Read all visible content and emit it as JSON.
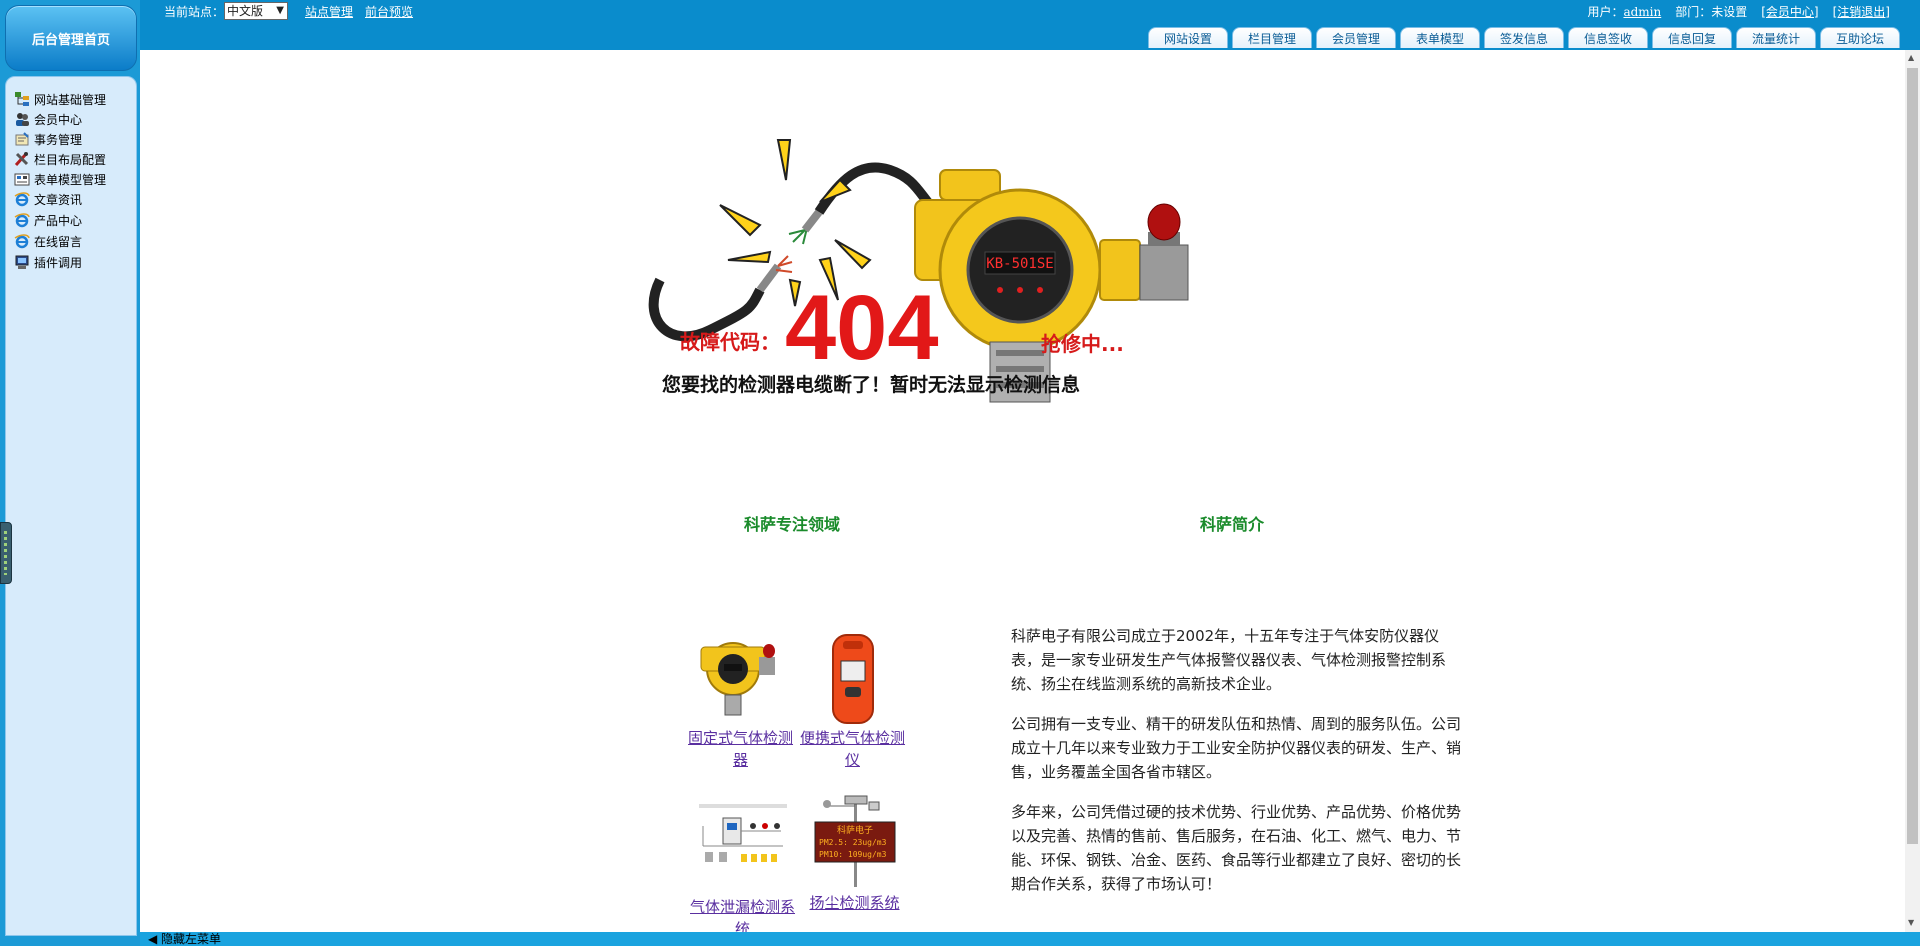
{
  "sidebar": {
    "home": "后台管理首页",
    "items": [
      {
        "label": "网站基础管理",
        "icon": "site-tree-icon"
      },
      {
        "label": "会员中心",
        "icon": "users-icon"
      },
      {
        "label": "事务管理",
        "icon": "tasks-icon"
      },
      {
        "label": "栏目布局配置",
        "icon": "tools-icon"
      },
      {
        "label": "表单模型管理",
        "icon": "form-icon"
      },
      {
        "label": "文章资讯",
        "icon": "ie-icon"
      },
      {
        "label": "产品中心",
        "icon": "ie-icon"
      },
      {
        "label": "在线留言",
        "icon": "ie-icon"
      },
      {
        "label": "插件调用",
        "icon": "computer-icon"
      }
    ]
  },
  "topbar": {
    "site_label": "当前站点：",
    "site_value": "中文版",
    "site_manage": "站点管理",
    "front_preview": "前台预览",
    "user_label": "用户：",
    "user_name": "admin",
    "dept": "部门：未设置",
    "member_center": "[会员中心]",
    "logout": "[注销退出]"
  },
  "tabs": [
    "网站设置",
    "栏目管理",
    "会员管理",
    "表单模型",
    "签发信息",
    "信息签收",
    "信息回复",
    "流量统计",
    "互助论坛"
  ],
  "error": {
    "code_label": "故障代码：",
    "code": "404",
    "repair": "抢修中...",
    "message": "您要找的检测器电缆断了！暂时无法显示检测信息",
    "device_text": "KB-501SE"
  },
  "focus": {
    "title": "科萨专注领域",
    "products": [
      {
        "name": "固定式气体检测器"
      },
      {
        "name": "便携式气体检测仪"
      },
      {
        "name": "气体泄漏检测系统"
      },
      {
        "name": "扬尘检测系统"
      }
    ]
  },
  "dust_display": {
    "brand": "科萨电子",
    "line1": "PM2.5:  23ug/m3",
    "line2": "PM10:  109ug/m3"
  },
  "intro": {
    "title": "科萨简介",
    "paragraphs": [
      "科萨电子有限公司成立于2002年，十五年专注于气体安防仪器仪表，是一家专业研发生产气体报警仪器仪表、气体检测报警控制系统、扬尘在线监测系统的高新技术企业。",
      "公司拥有一支专业、精干的研发队伍和热情、周到的服务队伍。公司成立十几年以来专业致力于工业安全防护仪器仪表的研发、生产、销售，业务覆盖全国各省市辖区。",
      "多年来，公司凭借过硬的技术优势、行业优势、产品优势、价格优势以及完善、热情的售前、售后服务，在石油、化工、燃气、电力、节能、环保、钢铁、冶金、医药、食品等行业都建立了良好、密切的长期合作关系，获得了市场认可！"
    ]
  },
  "bottom": {
    "hide_menu": "隐藏左菜单"
  }
}
